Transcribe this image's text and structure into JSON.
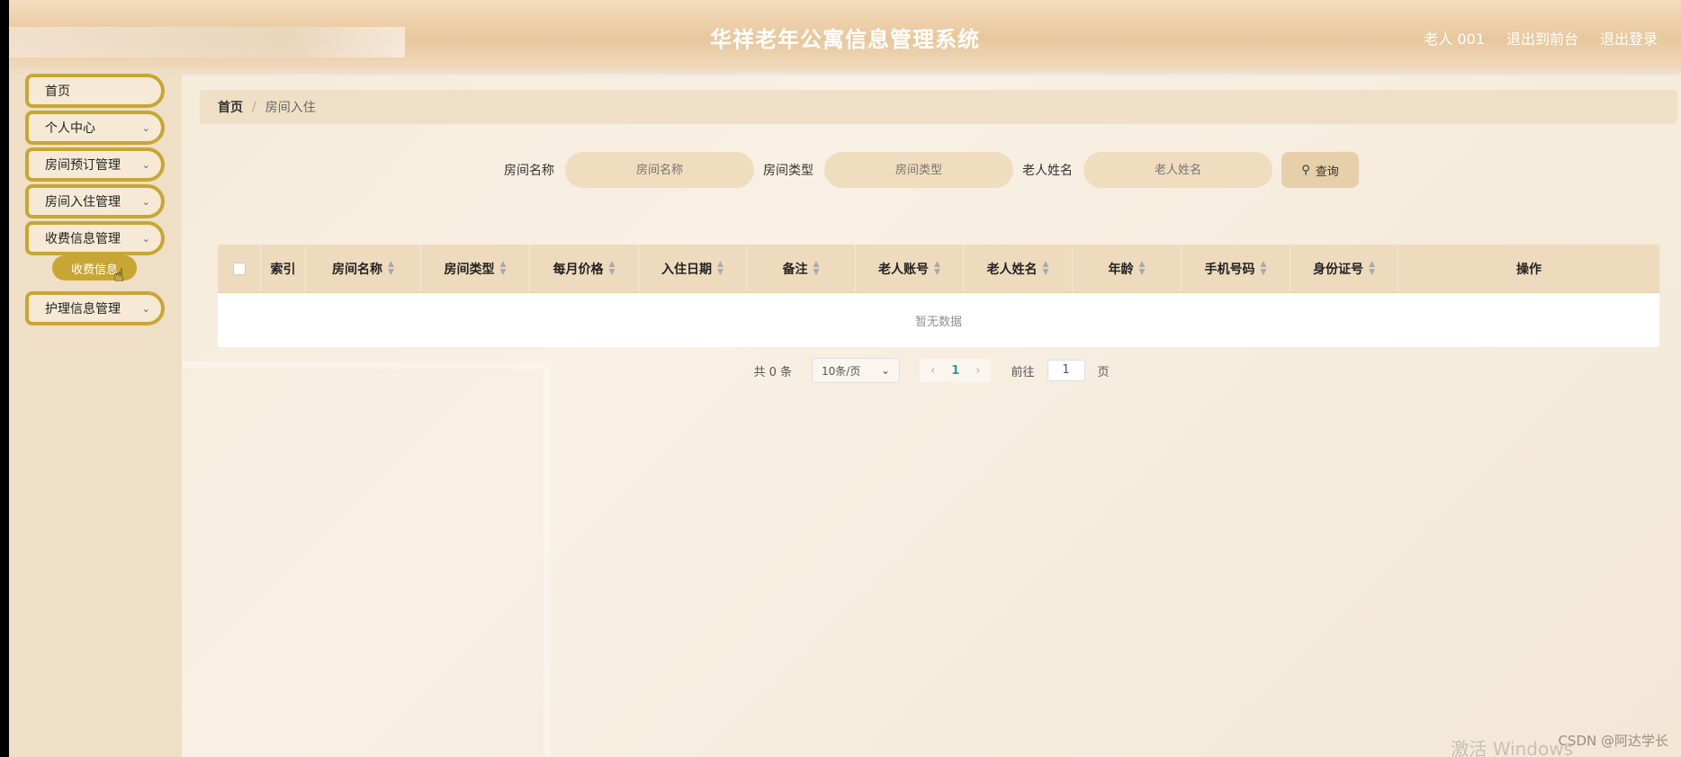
{
  "header": {
    "title": "华祥老年公寓信息管理系统",
    "user": "老人 001",
    "back_to_front": "退出到前台",
    "logout": "退出登录"
  },
  "sidebar": {
    "items": [
      {
        "label": "首页",
        "has_chevron": false
      },
      {
        "label": "个人中心",
        "has_chevron": true
      },
      {
        "label": "房间预订管理",
        "has_chevron": true
      },
      {
        "label": "房间入住管理",
        "has_chevron": true
      },
      {
        "label": "收费信息管理",
        "has_chevron": true
      },
      {
        "label": "护理信息管理",
        "has_chevron": true
      }
    ],
    "sub_item": "收费信息"
  },
  "breadcrumb": {
    "home": "首页",
    "separator": "/",
    "current": "房间入住"
  },
  "search": {
    "room_name_label": "房间名称",
    "room_name_placeholder": "房间名称",
    "room_type_label": "房间类型",
    "room_type_placeholder": "房间类型",
    "elder_name_label": "老人姓名",
    "elder_name_placeholder": "老人姓名",
    "query_button": "查询"
  },
  "table": {
    "columns": [
      "索引",
      "房间名称",
      "房间类型",
      "每月价格",
      "入住日期",
      "备注",
      "老人账号",
      "老人姓名",
      "年龄",
      "手机号码",
      "身份证号",
      "操作"
    ],
    "empty_text": "暂无数据"
  },
  "pagination": {
    "total": "共 0 条",
    "page_size": "10条/页",
    "current_page": "1",
    "goto_label": "前往",
    "goto_value": "1",
    "page_suffix": "页"
  },
  "overlay": {
    "watermark": "CSDN @阿达学长",
    "activate_windows": "激活 Windows"
  },
  "colors": {
    "accent_gold": "#c8a634",
    "header_bg": "#e8c79c",
    "sidebar_bg": "#efdfc6"
  }
}
